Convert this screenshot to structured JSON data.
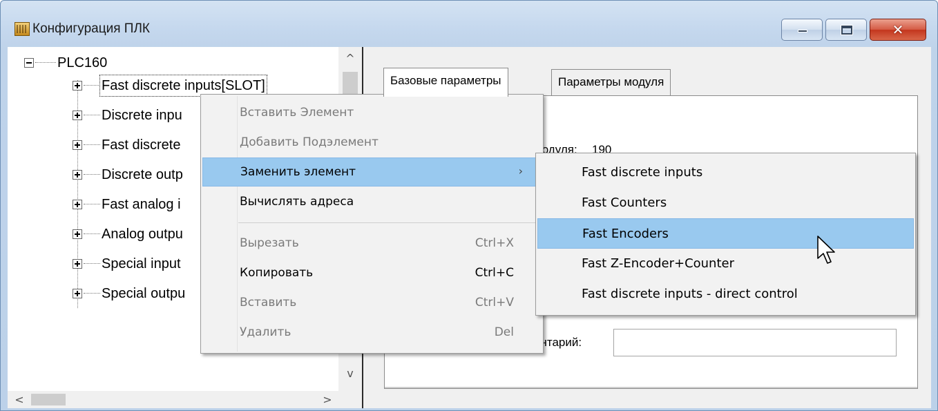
{
  "window": {
    "title": "Конфигурация ПЛК",
    "controls": {
      "minimize": "minimize",
      "maximize": "maximize",
      "close": "✕"
    },
    "accent": "#99c9ef"
  },
  "tree": {
    "root": "PLC160",
    "items": [
      "Fast discrete inputs[SLOT]",
      "Discrete inpu",
      "Fast discrete",
      "Discrete outp",
      "Fast analog i",
      "Analog outpu",
      "Special input",
      "Special outpu"
    ],
    "scroll_up": "^",
    "scroll_down": "v",
    "scroll_left": "<",
    "scroll_right": ">"
  },
  "tabs": {
    "items": [
      "Базовые параметры",
      "Параметры модуля"
    ],
    "active_index": 0
  },
  "panel": {
    "module_label": "модуля:",
    "module_value": "190",
    "comment_label": "ентарий:",
    "comment_value": ""
  },
  "context_menu": {
    "items": [
      {
        "label": "Вставить Элемент",
        "shortcut": "",
        "enabled": false
      },
      {
        "label": "Добавить Подэлемент",
        "shortcut": "",
        "enabled": false
      },
      {
        "label": "Заменить элемент",
        "shortcut": "",
        "enabled": true,
        "submenu": true,
        "arrow": "›"
      },
      {
        "label": "Вычислять адреса",
        "shortcut": "",
        "enabled": true
      },
      {
        "label": "Вырезать",
        "shortcut": "Ctrl+X",
        "enabled": false
      },
      {
        "label": "Копировать",
        "shortcut": "Ctrl+C",
        "enabled": true
      },
      {
        "label": "Вставить",
        "shortcut": "Ctrl+V",
        "enabled": false
      },
      {
        "label": "Удалить",
        "shortcut": "Del",
        "enabled": false
      }
    ]
  },
  "submenu": {
    "items": [
      "Fast discrete inputs",
      "Fast Counters",
      "Fast Encoders",
      "Fast Z-Encoder+Counter",
      "Fast discrete inputs - direct control"
    ],
    "highlighted_index": 2
  }
}
